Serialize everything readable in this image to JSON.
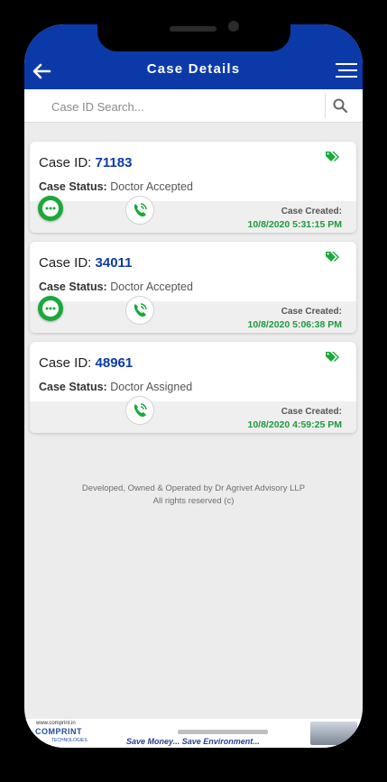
{
  "header": {
    "title": "Case Details"
  },
  "search": {
    "placeholder": "Case ID Search..."
  },
  "cases": [
    {
      "id_label": "Case ID:",
      "id": "71183",
      "status_label": "Case Status:",
      "status": "Doctor Accepted",
      "created_label": "Case Created:",
      "created": "10/8/2020 5:31:15 PM",
      "has_chat": true
    },
    {
      "id_label": "Case ID:",
      "id": "34011",
      "status_label": "Case Status:",
      "status": "Doctor Accepted",
      "created_label": "Case Created:",
      "created": "10/8/2020 5:06:38 PM",
      "has_chat": true
    },
    {
      "id_label": "Case ID:",
      "id": "48961",
      "status_label": "Case Status:",
      "status": "Doctor Assigned",
      "created_label": "Case Created:",
      "created": "10/8/2020 4:59:25 PM",
      "has_chat": false
    }
  ],
  "footer": {
    "line1": "Developed, Owned & Operated by Dr Agrivet Advisory LLP",
    "line2": "All rights reserved (c)"
  },
  "ad": {
    "url": "www.comprint.in",
    "brand": "COMPRINT",
    "brand_sub": "TECHNOLOGIES",
    "tagline": "Save Money... Save Environment..."
  },
  "colors": {
    "header": "#0b3aa8",
    "accent_green": "#1d9a3b",
    "case_id": "#0b3aa8"
  },
  "icons": {
    "back": "arrow-left-icon",
    "menu": "hamburger-menu-icon",
    "search": "search-icon",
    "tag": "tags-icon",
    "chat": "chat-bubble-icon",
    "call": "phone-call-icon"
  }
}
